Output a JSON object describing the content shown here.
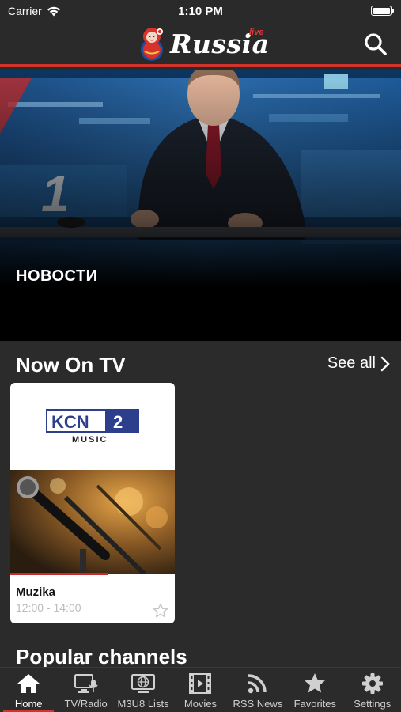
{
  "status": {
    "carrier": "Carrier",
    "time": "1:10 PM"
  },
  "header": {
    "logo_text": "Russia",
    "logo_badge": "live"
  },
  "hero": {
    "title": "НОВОСТИ"
  },
  "now_on_tv": {
    "heading": "Now On TV",
    "see_all": "See all",
    "cards": [
      {
        "logo_main": "KCN",
        "logo_num": "2",
        "logo_sub": "MUSIC",
        "title": "Muzika",
        "time": "12:00 - 14:00",
        "progress": 0.59
      }
    ]
  },
  "popular": {
    "heading": "Popular channels"
  },
  "tabs": [
    {
      "label": "Home",
      "icon": "home-icon",
      "active": true
    },
    {
      "label": "TV/Radio",
      "icon": "tv-radio-icon"
    },
    {
      "label": "M3U8 Lists",
      "icon": "globe-list-icon"
    },
    {
      "label": "Movies",
      "icon": "film-icon"
    },
    {
      "label": "RSS News",
      "icon": "rss-icon"
    },
    {
      "label": "Favorites",
      "icon": "star-icon"
    },
    {
      "label": "Settings",
      "icon": "gear-icon"
    }
  ],
  "colors": {
    "accent": "#d0342c",
    "background": "#2b2b2b"
  }
}
